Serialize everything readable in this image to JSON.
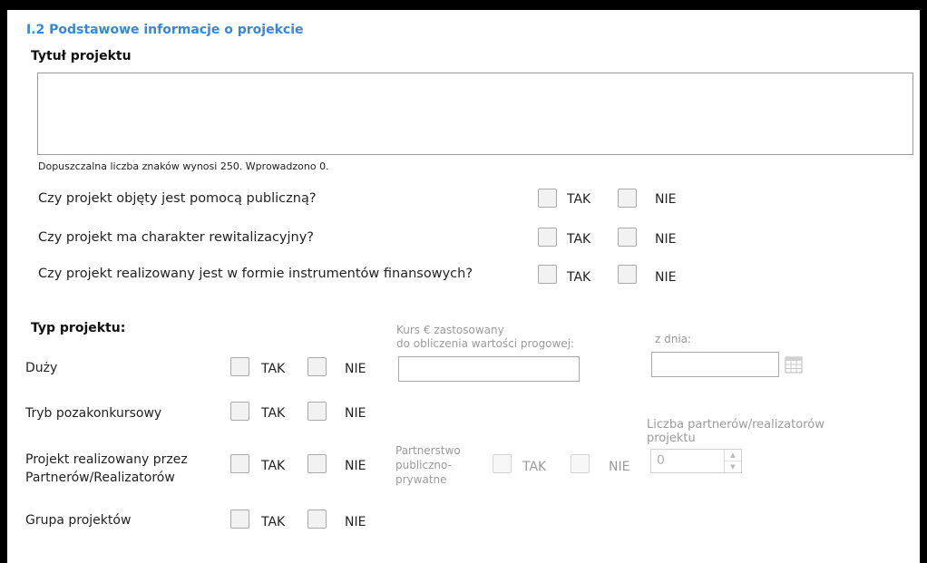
{
  "section": {
    "title": "I.2 Podstawowe informacje o projekcie",
    "project_title_label": "Tytuł projektu",
    "char_counter": "Dopuszczalna liczba znaków wynosi 250. Wprowadzono 0."
  },
  "options": {
    "yes": "TAK",
    "no": "NIE"
  },
  "questions": [
    "Czy projekt objęty jest  pomocą publiczną?",
    "Czy projekt ma charakter rewitalizacyjny?",
    "Czy projekt realizowany jest w formie instrumentów finansowych?"
  ],
  "project_type": {
    "heading": "Typ projektu:",
    "rows": [
      "Duży",
      "Tryb pozakonkursowy",
      "Projekt realizowany przez Partnerów/Realizatorów",
      "Grupa projektów"
    ],
    "row3_line1": "Projekt realizowany przez",
    "row3_line2": "Partnerów/Realizatorów"
  },
  "exchange_rate": {
    "label_line1": "Kurs € zastosowany",
    "label_line2": "do obliczenia wartości progowej:",
    "value": "",
    "date_label": "z dnia:",
    "date_value": ""
  },
  "ppp": {
    "label_line1": "Partnerstwo",
    "label_line2": "publiczno-",
    "label_line3": "prywatne"
  },
  "partners_count": {
    "label_line1": "Liczba partnerów/realizatorów",
    "label_line2": "projektu",
    "value": "0"
  }
}
